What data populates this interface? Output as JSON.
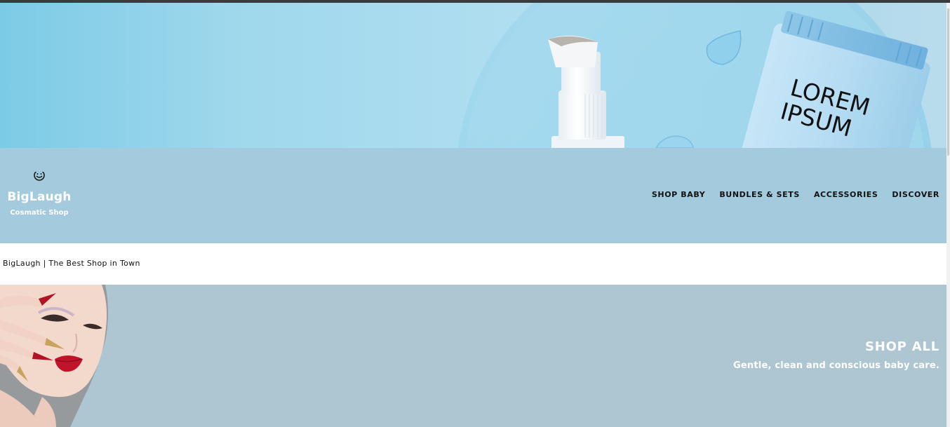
{
  "hero": {
    "product_text": "LOREM\nIPSUM",
    "colors": {
      "sky": "#a9d8ea",
      "tube": "#bcdff3"
    }
  },
  "header": {
    "logo_icon": "smiley-icon",
    "brand_name": "BigLaugh",
    "tagline": "Cosmatic Shop",
    "nav": [
      {
        "label": "SHOP BABY"
      },
      {
        "label": "BUNDLES & SETS"
      },
      {
        "label": "ACCESSORIES"
      },
      {
        "label": "DISCOVER"
      }
    ],
    "colors": {
      "background": "#a3cadd"
    }
  },
  "site_title": "BigLaugh | The Best Shop in Town",
  "promo": {
    "title": "SHOP ALL",
    "subtitle": "Gentle, clean and conscious baby care.",
    "colors": {
      "background": "#aec5d2",
      "text": "#ffffff"
    }
  }
}
